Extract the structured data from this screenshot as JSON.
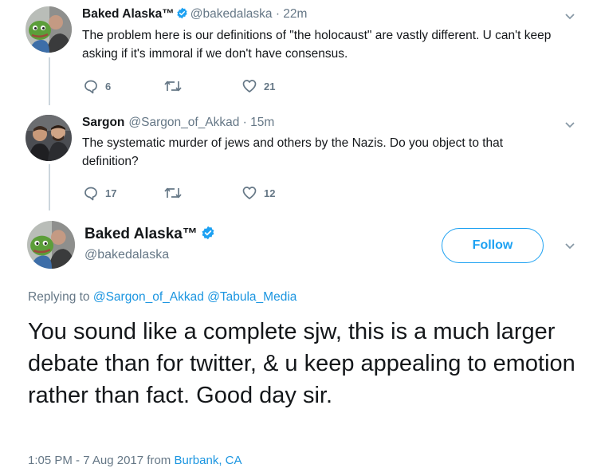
{
  "tweets": [
    {
      "name": "Baked Alaska™",
      "handle": "@bakedalaska · 22m",
      "verified": true,
      "text": "The problem here is our definitions of \"the holocaust\" are vastly different. U can't keep asking if it's immoral if we don't have consensus.",
      "replies": "6",
      "retweets": "",
      "likes": "21"
    },
    {
      "name": "Sargon",
      "handle": "@Sargon_of_Akkad · 15m",
      "verified": false,
      "text": "The systematic murder of jews and others by the Nazis. Do you object to that definition?",
      "replies": "17",
      "retweets": "",
      "likes": "12"
    }
  ],
  "main_tweet": {
    "name": "Baked Alaska™",
    "handle": "@bakedalaska",
    "verified": true,
    "follow_label": "Follow",
    "replying_prefix": "Replying to",
    "replying_to": [
      "@Sargon_of_Akkad",
      "@Tabula_Media"
    ],
    "text": "You sound like a complete sjw, this is a much larger debate than for twitter, & u keep appealing to emotion rather than fact. Good day sir.",
    "time": "1:05 PM - 7 Aug 2017",
    "from_word": "from",
    "location": "Burbank, CA"
  },
  "icons": {
    "reply": "reply-icon",
    "retweet": "retweet-icon",
    "like": "heart-icon",
    "more": "chevron-down-icon",
    "verified": "verified-badge-icon"
  },
  "colors": {
    "accent": "#1da1f2",
    "link": "#1b95e0",
    "muted": "#657786",
    "text": "#14171a",
    "thread_line": "#ccd6dd"
  }
}
